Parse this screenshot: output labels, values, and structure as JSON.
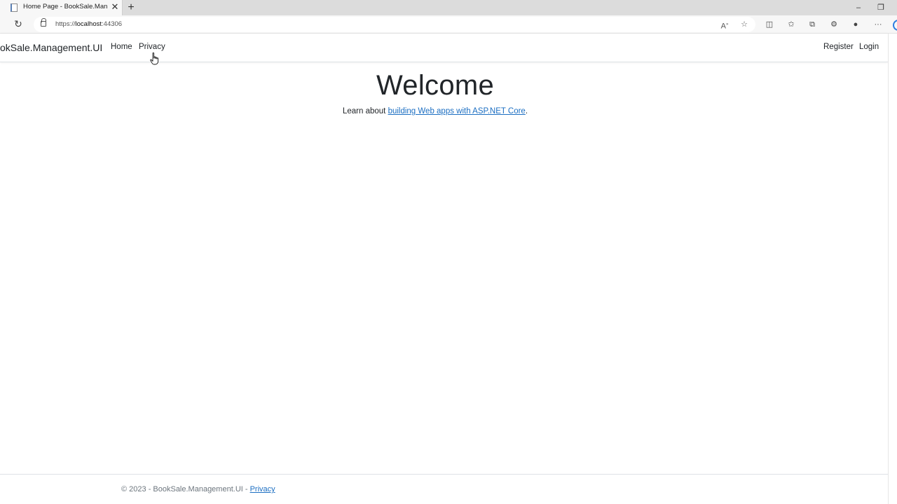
{
  "browser": {
    "tab_title": "Home Page - BookSale.Management.UI",
    "url_prefix": "https://",
    "url_host": "localhost",
    "url_port": ":44306",
    "icons": {
      "favicon": "page-icon",
      "close": "close-icon",
      "new_tab": "plus-icon",
      "reload": "reload-icon",
      "lock": "lock-icon",
      "read_aloud": "read-aloud-icon",
      "favorite": "star-icon",
      "split_screen": "split-screen-icon",
      "favorites": "favorites-icon",
      "collections": "collections-icon",
      "extensions": "extensions-icon",
      "profile": "profile-icon",
      "more": "more-icon"
    },
    "window": {
      "minimize": "–",
      "restore": "❐"
    }
  },
  "navbar": {
    "brand": "okSale.Management.UI",
    "links": {
      "home": "Home",
      "privacy": "Privacy",
      "register": "Register",
      "login": "Login"
    }
  },
  "main": {
    "heading": "Welcome",
    "learn_prefix": "Learn about ",
    "learn_link": "building Web apps with ASP.NET Core",
    "learn_suffix": "."
  },
  "footer": {
    "text": "© 2023 - BookSale.Management.UI - ",
    "privacy_link": "Privacy"
  },
  "colors": {
    "link": "#1b6ec2",
    "text": "#212529",
    "muted": "#6c757d",
    "accent": "#2b7de0"
  }
}
